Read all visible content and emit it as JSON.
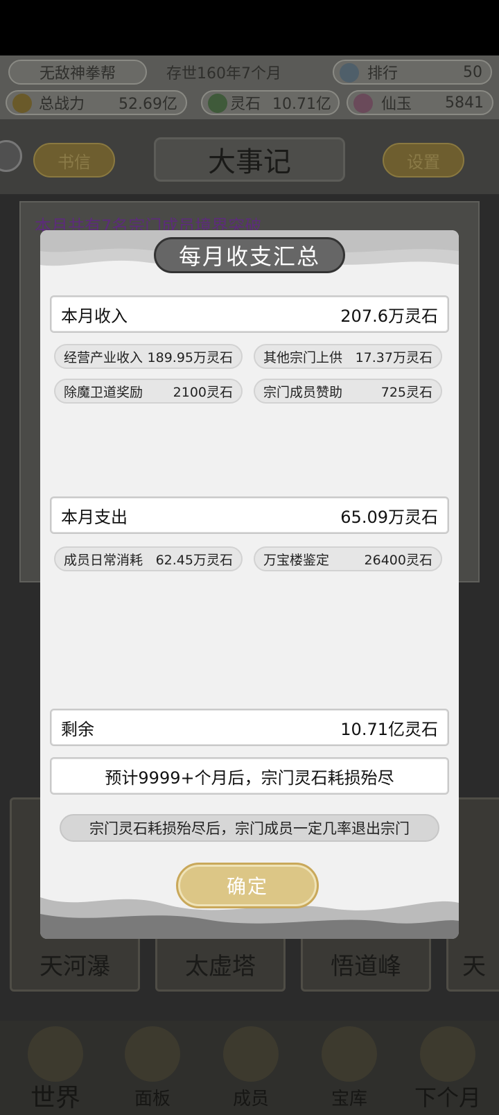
{
  "topbar": {
    "sect_name": "无敌神拳帮",
    "sect_age": "存世160年7个月",
    "rank_label": "排行",
    "rank_value": "50",
    "power_label": "总战力",
    "power_value": "52.69亿",
    "stone_label": "灵石",
    "stone_value": "10.71亿",
    "jade_label": "仙玉",
    "jade_value": "5841"
  },
  "menubar": {
    "letters": "书信",
    "chronicle": "大事记",
    "settings": "设置"
  },
  "log": {
    "line1": "本月共有7名宗门成员境界突破"
  },
  "scenes": [
    "天河瀑",
    "太虚塔",
    "悟道峰",
    "天"
  ],
  "nav": {
    "world": "世界",
    "panel": "面板",
    "members": "成员",
    "treasury": "宝库",
    "next_month": "下个月"
  },
  "modal": {
    "title": "每月收支汇总",
    "income": {
      "label": "本月收入",
      "value": "207.6万灵石"
    },
    "income_items": [
      {
        "label": "经营产业收入",
        "value": "189.95万灵石"
      },
      {
        "label": "其他宗门上供",
        "value": "17.37万灵石"
      },
      {
        "label": "除魔卫道奖励",
        "value": "2100灵石"
      },
      {
        "label": "宗门成员赞助",
        "value": "725灵石"
      }
    ],
    "expense": {
      "label": "本月支出",
      "value": "65.09万灵石"
    },
    "expense_items": [
      {
        "label": "成员日常消耗",
        "value": "62.45万灵石"
      },
      {
        "label": "万宝楼鉴定",
        "value": "26400灵石"
      }
    ],
    "remain": {
      "label": "剩余",
      "value": "10.71亿灵石"
    },
    "forecast": "预计9999+个月后，宗门灵石耗损殆尽",
    "warning": "宗门灵石耗损殆尽后，宗门成员一定几率退出宗门",
    "confirm": "确定"
  },
  "colors": {
    "overlay_dim": "#2b2b2b",
    "modal_bg": "#f1f1f1",
    "title_pill": "#666666",
    "confirm_gold": "#dcc686"
  }
}
